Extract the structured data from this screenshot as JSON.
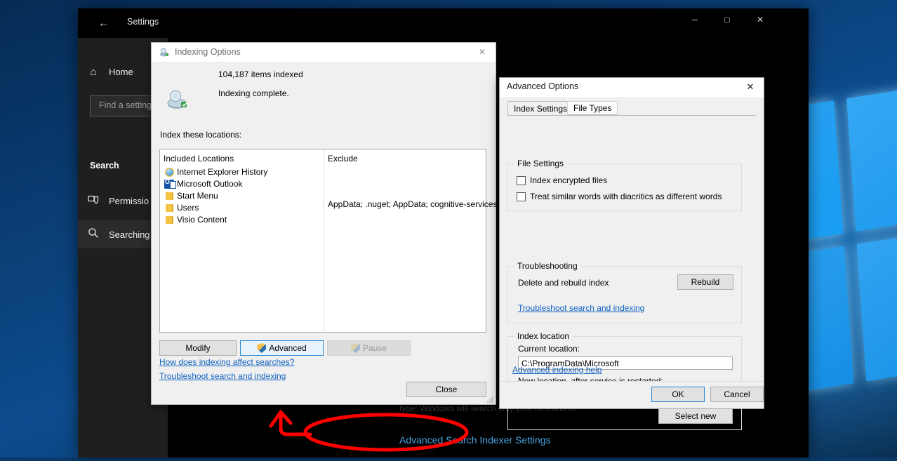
{
  "desktop": {
    "wallpaper": "windows-10-blue-logo"
  },
  "settings_window": {
    "title": "Settings",
    "back_icon": "←",
    "window_buttons": {
      "minimize": "─",
      "maximize": "□",
      "close": "✕"
    },
    "sidebar": {
      "home_label": "Home",
      "home_icon": "⌂",
      "search_placeholder": "Find a setting",
      "heading": "Search",
      "items": [
        {
          "label": "Permissio",
          "icon": "shield-icon"
        },
        {
          "label": "Searching",
          "icon": "magnifier-icon"
        }
      ]
    },
    "content": {
      "ghost_text": "type: Windows will search only your files and the...",
      "advanced_link": "Advanced Search Indexer Settings"
    }
  },
  "indexing_dialog": {
    "title": "Indexing Options",
    "title_icon": "indexing-icon",
    "close_icon": "✕",
    "items_indexed": "104,187 items indexed",
    "status": "Indexing complete.",
    "locations_label": "Index these locations:",
    "list": {
      "col_included": "Included Locations",
      "col_exclude": "Exclude",
      "rows": [
        {
          "name": "Internet Explorer History",
          "icon": "internet-explorer-icon"
        },
        {
          "name": "Microsoft Outlook",
          "icon": "outlook-icon"
        },
        {
          "name": "Start Menu",
          "icon": "folder-icon"
        },
        {
          "name": "Users",
          "icon": "folder-icon"
        },
        {
          "name": "Visio Content",
          "icon": "folder-icon"
        }
      ],
      "exclude_value": "AppData; .nuget; AppData; cognitive-services..."
    },
    "buttons": {
      "modify": "Modify",
      "advanced": "Advanced",
      "pause": "Pause",
      "close": "Close"
    },
    "links": {
      "how": "How does indexing affect searches?",
      "troubleshoot": "Troubleshoot search and indexing"
    }
  },
  "advanced_dialog": {
    "title": "Advanced Options",
    "close_icon": "✕",
    "tabs": [
      {
        "label": "Index Settings",
        "selected": true
      },
      {
        "label": "File Types",
        "selected": false
      }
    ],
    "file_settings": {
      "group_title": "File Settings",
      "checkboxes": [
        {
          "label": "Index encrypted files",
          "checked": false
        },
        {
          "label": "Treat similar words with diacritics as different words",
          "checked": false
        }
      ]
    },
    "troubleshooting": {
      "group_title": "Troubleshooting",
      "rebuild_label": "Delete and rebuild index",
      "rebuild_button": "Rebuild",
      "link": "Troubleshoot search and indexing"
    },
    "index_location": {
      "group_title": "Index location",
      "current_label": "Current location:",
      "current_value": "C:\\ProgramData\\Microsoft",
      "new_label": "New location, after service is restarted:",
      "new_value": "",
      "select_button": "Select new"
    },
    "help_link": "Advanced indexing help",
    "footer": {
      "ok": "OK",
      "cancel": "Cancel"
    }
  },
  "annotation": {
    "type": "red-handdrawn-arrow-and-ellipse",
    "target": "Advanced Search Indexer Settings",
    "color": "#ff0000"
  }
}
